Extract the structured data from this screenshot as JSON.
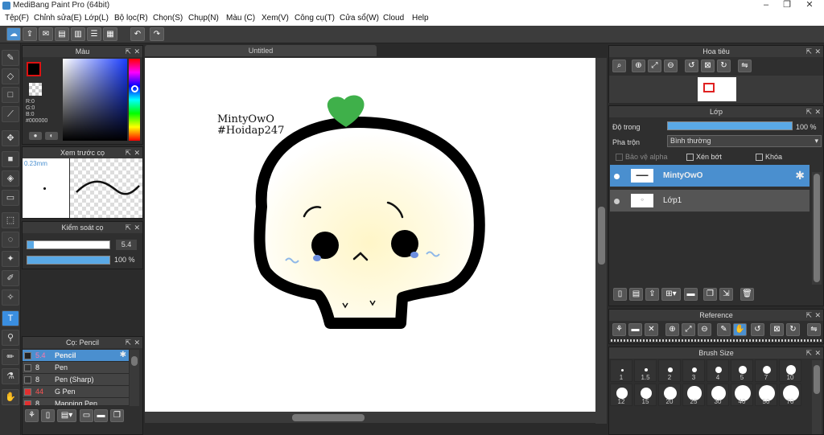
{
  "window": {
    "title": "MediBang Paint Pro (64bit)"
  },
  "menu": [
    "Tệp(F)",
    "Chỉnh sửa(E)",
    "Lớp(L)",
    "Bộ lọc(R)",
    "Chọn(S)",
    "Chụp(N)",
    "Màu (C)",
    "Xem(V)",
    "Công cụ(T)",
    "Cửa sổ(W)",
    "Cloud",
    "Help"
  ],
  "color_panel": {
    "title": "Màu",
    "r": "R:0",
    "g": "G:0",
    "b": "B:0",
    "hex": "#000000"
  },
  "brush_preview": {
    "title": "Xem trước cọ",
    "size": "0.23mm"
  },
  "brush_control": {
    "title": "Kiểm soát cọ",
    "size_value": "5.4",
    "opacity_value": "100 %"
  },
  "brush_list": {
    "title": "Cọ: Pencil",
    "items": [
      {
        "size": "5.4",
        "name": "Pencil",
        "color": "#222222"
      },
      {
        "size": "8",
        "name": "Pen",
        "color": "#333333"
      },
      {
        "size": "8",
        "name": "Pen (Sharp)",
        "color": "#333333"
      },
      {
        "size": "44",
        "name": "G Pen",
        "color": "#e03030"
      },
      {
        "size": "8",
        "name": "Mapping Pen",
        "color": "#e03030"
      }
    ]
  },
  "canvas": {
    "tab": "Untitled",
    "text_line1": "MintyOwO",
    "text_line2": "#Hoidap247"
  },
  "navigator": {
    "title": "Hoa tiêu"
  },
  "layer_panel": {
    "title": "Lớp",
    "opacity_label": "Độ trong",
    "opacity_value": "100 %",
    "blend_label": "Pha trộn",
    "blend_value": "Bình thường",
    "protect_alpha": "Bảo vệ alpha",
    "clipping": "Xén bớt",
    "lock": "Khóa",
    "layers": [
      {
        "name": "MintyOwO",
        "selected": true
      },
      {
        "name": "Lớp1",
        "selected": false
      }
    ]
  },
  "reference": {
    "title": "Reference"
  },
  "brush_size": {
    "title": "Brush Size",
    "sizes": [
      "1",
      "1.5",
      "2",
      "3",
      "4",
      "5",
      "7",
      "10",
      "12",
      "15",
      "20",
      "25",
      "30",
      "40",
      "50",
      "70"
    ]
  }
}
